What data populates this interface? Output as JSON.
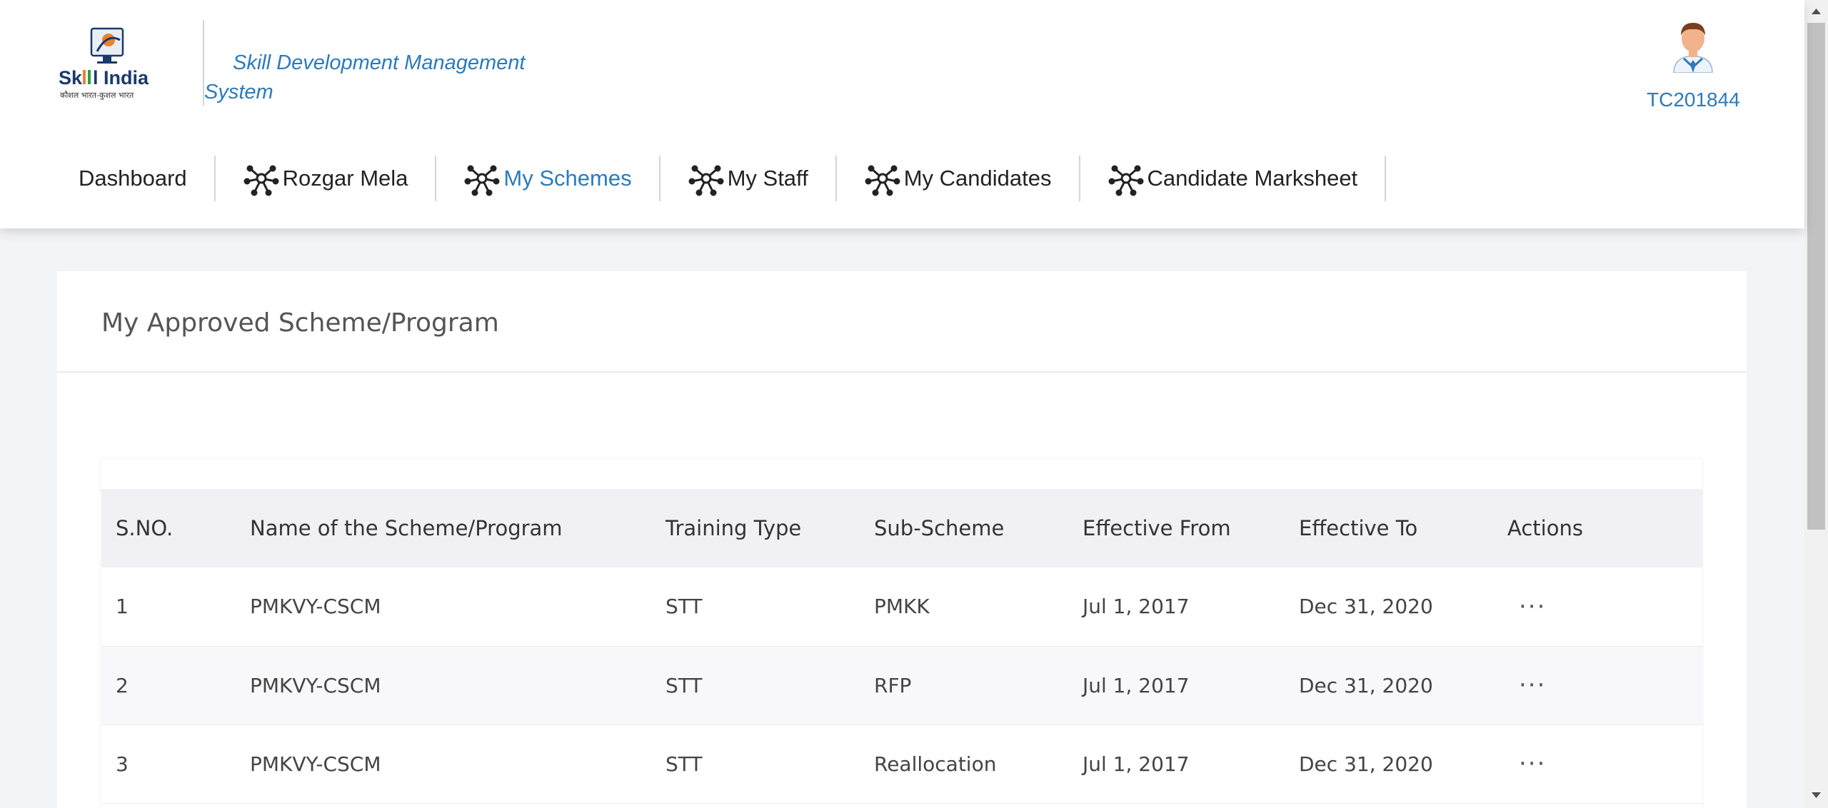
{
  "brand": {
    "logo_text": "Skill India",
    "logo_tagline": "कौशल भारत-कुशल भारत",
    "system_title": "Skill Development Management System"
  },
  "user": {
    "id": "TC201844",
    "avatar_icon": "user-avatar-icon"
  },
  "nav": {
    "items": [
      {
        "label": "Dashboard",
        "icon": "",
        "active": false
      },
      {
        "label": "Rozgar Mela",
        "icon": "network-icon",
        "active": false
      },
      {
        "label": "My Schemes",
        "icon": "network-icon",
        "active": true
      },
      {
        "label": "My Staff",
        "icon": "network-icon",
        "active": false
      },
      {
        "label": "My Candidates",
        "icon": "network-icon",
        "active": false
      },
      {
        "label": "Candidate Marksheet",
        "icon": "network-icon",
        "active": false
      }
    ]
  },
  "card": {
    "title": "My Approved Scheme/Program"
  },
  "table": {
    "columns": [
      "S.NO.",
      "Name of the Scheme/Program",
      "Training Type",
      "Sub-Scheme",
      "Effective From",
      "Effective To",
      "Actions"
    ],
    "rows": [
      {
        "sno": "1",
        "name": "PMKVY-CSCM",
        "training_type": "STT",
        "sub_scheme": "PMKK",
        "effective_from": "Jul 1, 2017",
        "effective_to": "Dec 31, 2020",
        "actions": "···"
      },
      {
        "sno": "2",
        "name": "PMKVY-CSCM",
        "training_type": "STT",
        "sub_scheme": "RFP",
        "effective_from": "Jul 1, 2017",
        "effective_to": "Dec 31, 2020",
        "actions": "···"
      },
      {
        "sno": "3",
        "name": "PMKVY-CSCM",
        "training_type": "STT",
        "sub_scheme": "Reallocation",
        "effective_from": "Jul 1, 2017",
        "effective_to": "Dec 31, 2020",
        "actions": "···"
      }
    ]
  },
  "colors": {
    "accent": "#2a7bbd",
    "page_bg": "#f3f4f7",
    "header_row_bg": "#f1f1f5"
  }
}
